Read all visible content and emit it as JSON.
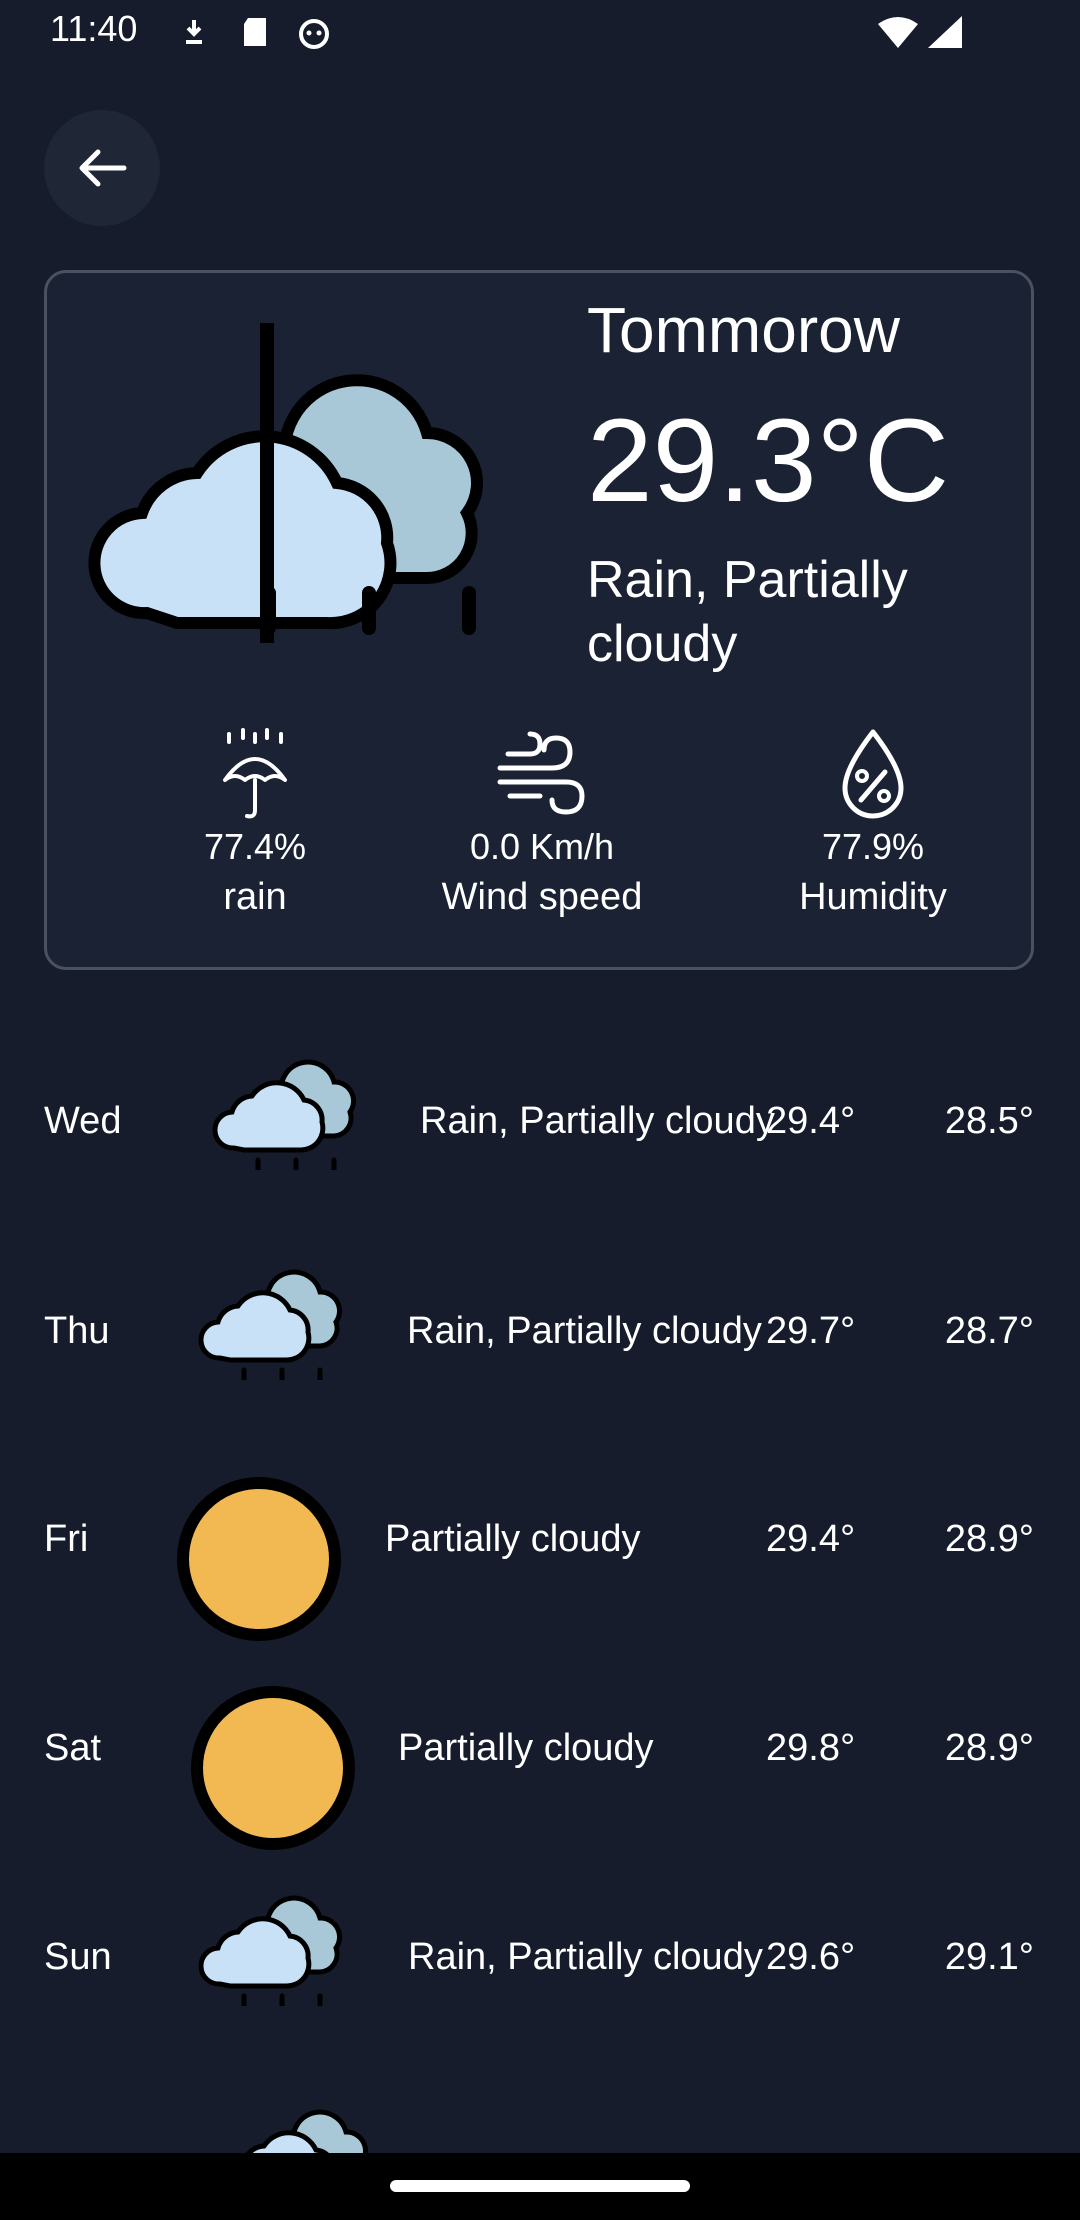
{
  "status_bar": {
    "time": "11:40",
    "icons": [
      "download-icon",
      "sd-card-icon",
      "cat-icon",
      "wifi-icon",
      "signal-icon"
    ]
  },
  "header": {
    "back_icon": "arrow-left-icon"
  },
  "today_card": {
    "day": "Tommorow",
    "temperature": "29.3°C",
    "description": "Rain, Partially cloudy",
    "icon": "rain-cloud-icon",
    "metrics": [
      {
        "icon": "umbrella-icon",
        "value": "77.4%",
        "label": "rain"
      },
      {
        "icon": "wind-icon",
        "value": "0.0 Km/h",
        "label": "Wind speed"
      },
      {
        "icon": "humidity-drop-icon",
        "value": "77.9%",
        "label": "Humidity"
      }
    ]
  },
  "forecast": [
    {
      "day": "Wed",
      "icon": "rain-cloud-icon",
      "description": "Rain, Partially cloudy",
      "high": "29.4°",
      "low": "28.5°"
    },
    {
      "day": "Thu",
      "icon": "rain-cloud-icon",
      "description": "Rain, Partially cloudy",
      "high": "29.7°",
      "low": "28.7°"
    },
    {
      "day": "Fri",
      "icon": "sun-icon",
      "description": "Partially cloudy",
      "high": "29.4°",
      "low": "28.9°"
    },
    {
      "day": "Sat",
      "icon": "sun-icon",
      "description": "Partially cloudy",
      "high": "29.8°",
      "low": "28.9°"
    },
    {
      "day": "Sun",
      "icon": "rain-cloud-icon",
      "description": "Rain, Partially cloudy",
      "high": "29.6°",
      "low": "29.1°"
    }
  ],
  "colors": {
    "background": "#161c2b",
    "card": "#1a2233",
    "cloud_front": "#c8e1f7",
    "cloud_back": "#a8c8d8",
    "sun": "#f2b852"
  }
}
